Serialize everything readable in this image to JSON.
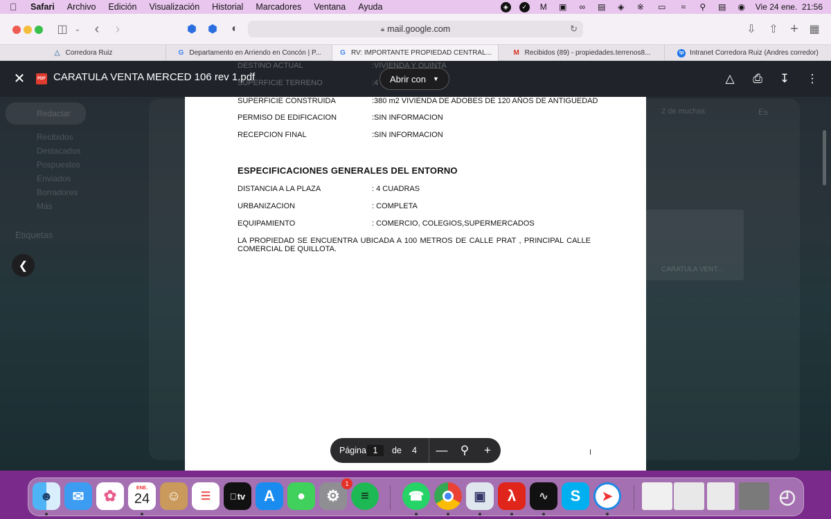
{
  "menubar": {
    "items": [
      "Safari",
      "Archivo",
      "Edición",
      "Visualización",
      "Historial",
      "Marcadores",
      "Ventana",
      "Ayuda"
    ],
    "datetime": "Vie 24 ene.  21:56"
  },
  "browser": {
    "url": "mail.google.com",
    "tabs": [
      {
        "label": "Corredora Ruiz",
        "icon": "corredora-logo"
      },
      {
        "label": "Departamento en Arriendo en Concón | P...",
        "icon": "google-g"
      },
      {
        "label": "RV: IMPORTANTE PROPIEDAD CENTRAL...",
        "icon": "google-g"
      },
      {
        "label": "Recibidos (89) - propiedades.terrenos8...",
        "icon": "gmail-m"
      },
      {
        "label": "Intranet Corredora Ruiz (Andres corredor)",
        "icon": "intranet-logo"
      }
    ],
    "active_tab": 2
  },
  "gmail_bg": {
    "compose": "Redactar",
    "nav": [
      "Recibidos",
      "Destacados",
      "Pospuestos",
      "Enviados",
      "Borradores",
      "Más"
    ],
    "labels": "Etiquetas",
    "pagination": "2 de muchas",
    "lang": "Es",
    "attachment_name": "CARATULA VENT..."
  },
  "viewer": {
    "file_name": "CARATULA VENTA MERCED 106 rev 1.pdf",
    "open_with": "Abrir con",
    "cut_rows": [
      {
        "label": "DESTINO ACTUAL",
        "value": ":VIVIENDA Y QUINTA"
      },
      {
        "label": "SUPERFICIE TERRENO",
        "value": ":4"
      }
    ],
    "rows_top": [
      {
        "label": "SUPERFICIE CONSTRUIDA",
        "value": ":380 m2 VIVIENDA DE ADOBES DE 120 AÑOS DE ANTIGUEDAD"
      },
      {
        "label": "PERMISO DE EDIFICACION",
        "value": ":SIN INFORMACION"
      },
      {
        "label": "RECEPCION FINAL",
        "value": ":SIN INFORMACION"
      }
    ],
    "section_heading": "ESPECIFICACIONES GENERALES DEL ENTORNO",
    "rows_env": [
      {
        "label": "DISTANCIA A LA PLAZA",
        "value": ": 4 CUADRAS"
      },
      {
        "label": "URBANIZACION",
        "value": ": COMPLETA"
      },
      {
        "label": "EQUIPAMIENTO",
        "value": ": COMERCIO, COLEGIOS,SUPERMERCADOS"
      }
    ],
    "paragraph": "LA PROPIEDAD SE ENCUENTRA UBICADA A 100 METROS DE CALLE PRAT , PRINCIPAL CALLE COMERCIAL DE QUILLOTA.",
    "page_label": "Página",
    "page_current": "1",
    "page_of": "de",
    "page_total": "4"
  },
  "dock": {
    "calendar_month": "ENE.",
    "calendar_day": "24",
    "appletv": "tv",
    "settings_badge": "1"
  }
}
